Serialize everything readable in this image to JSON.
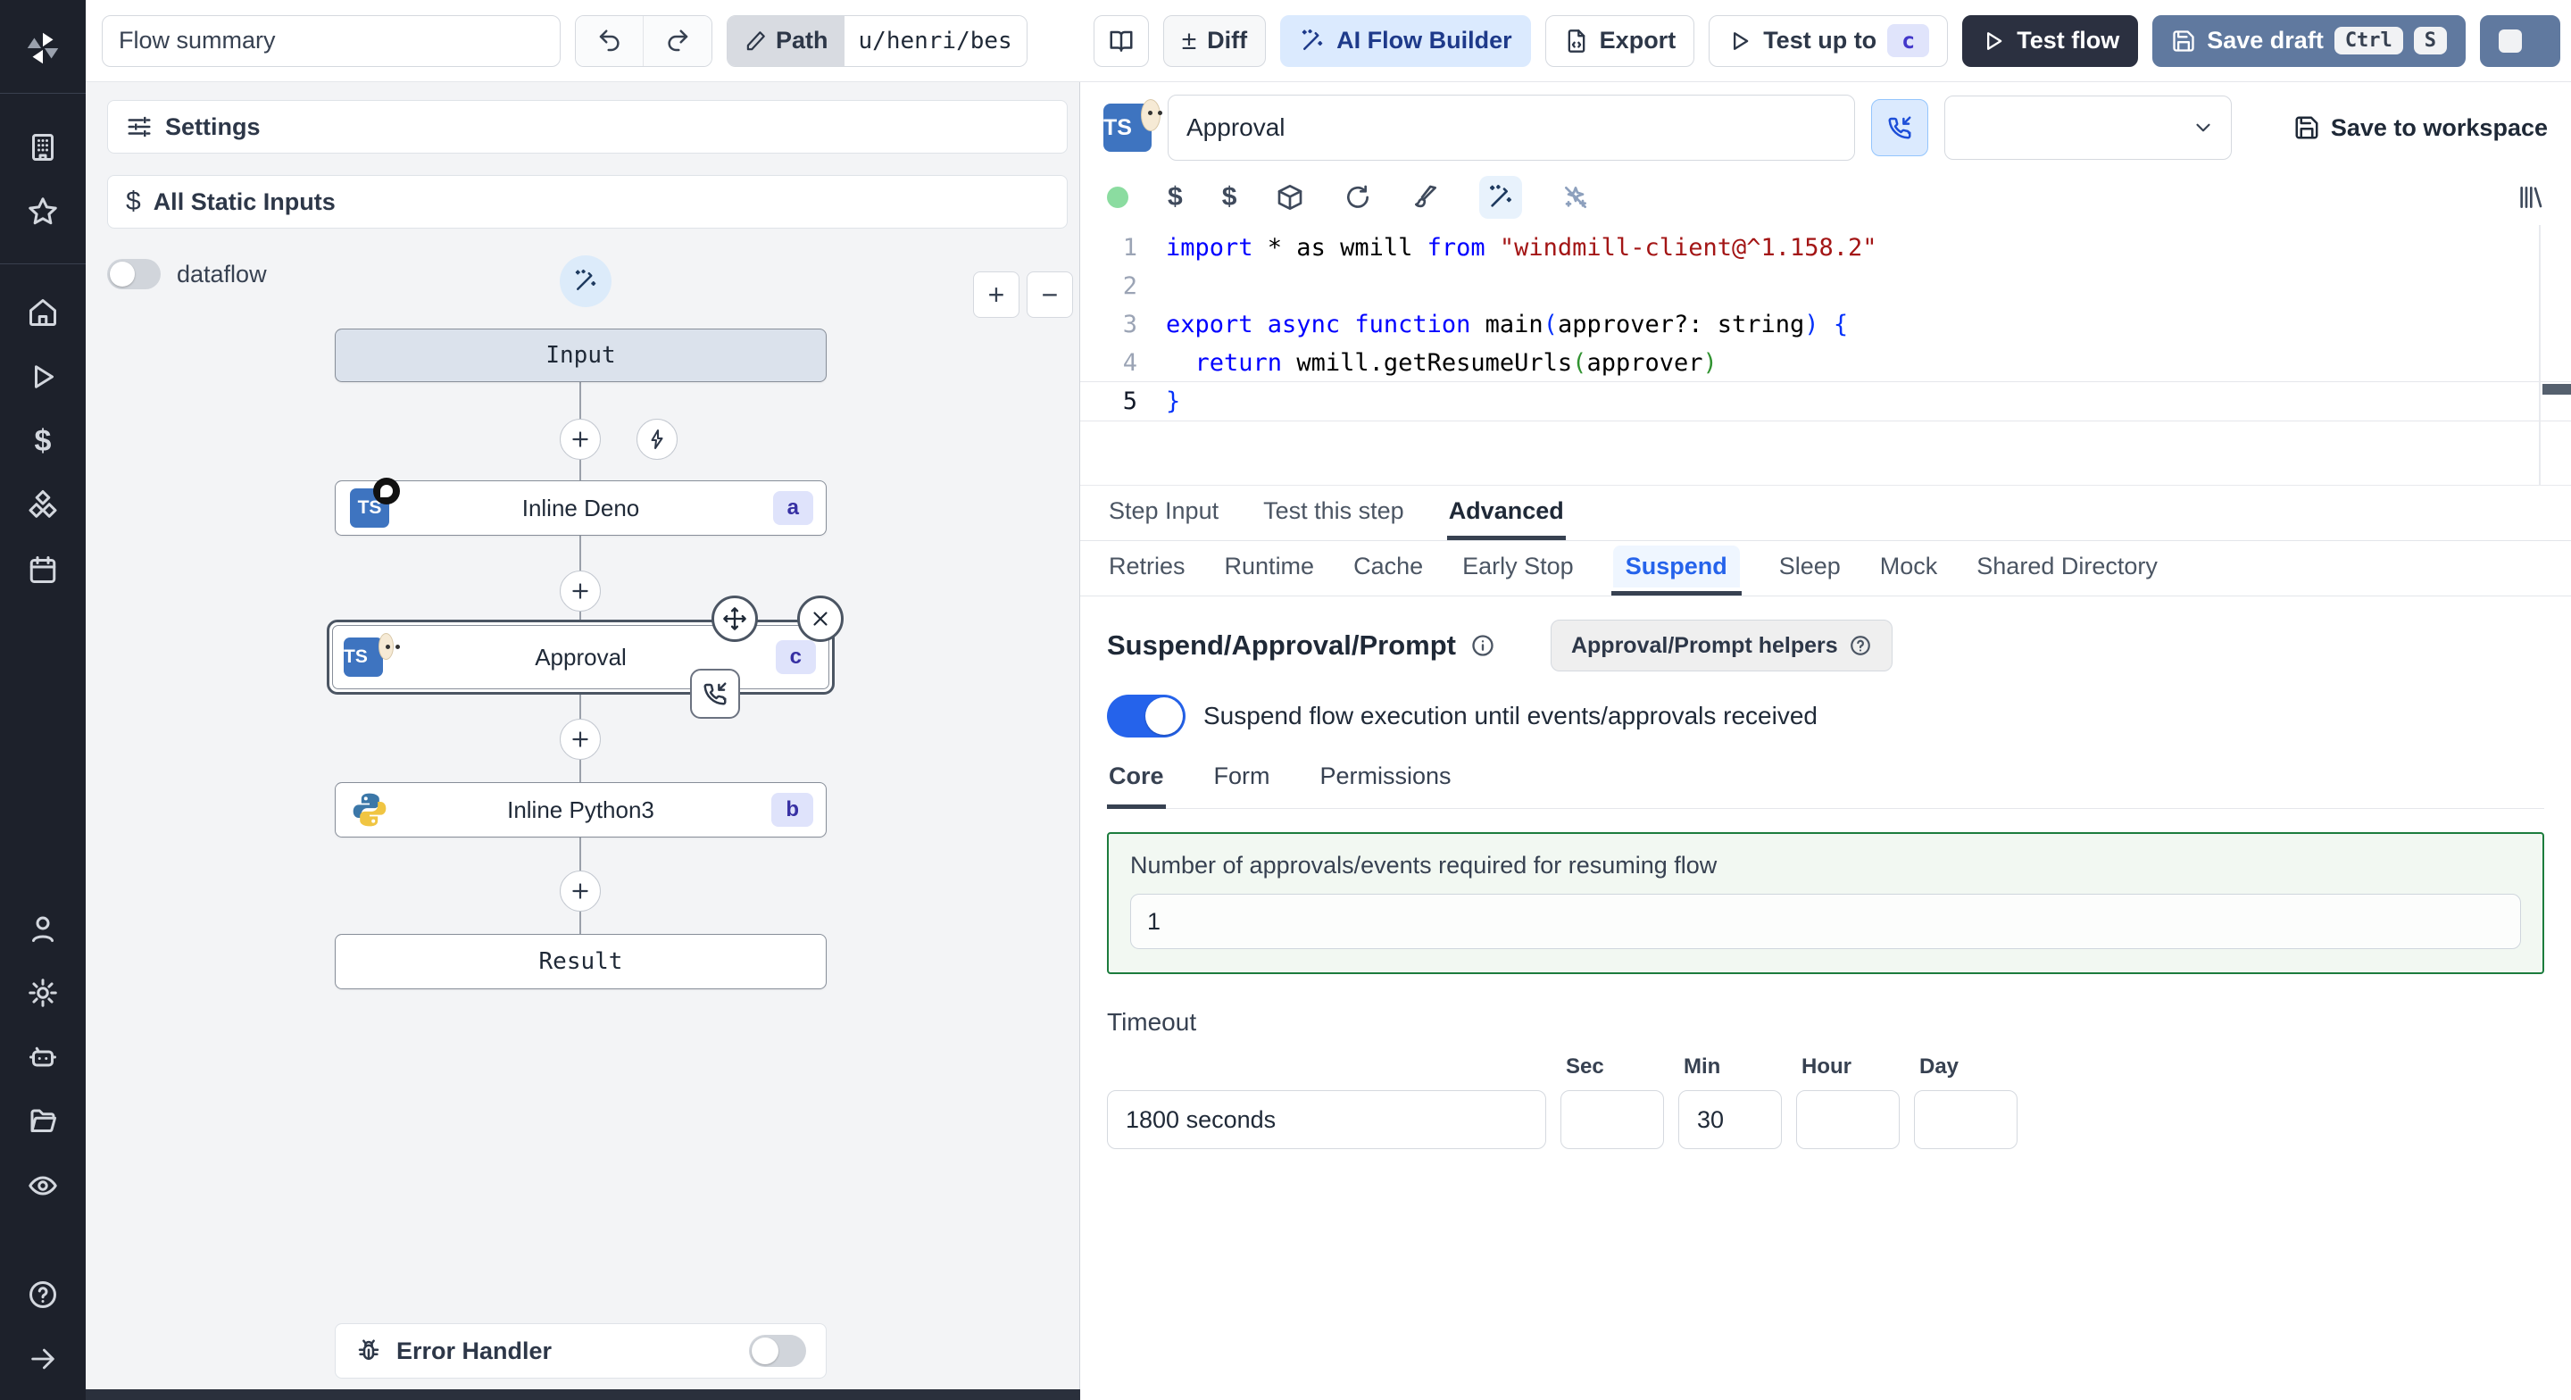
{
  "toolbar": {
    "flow_summary_value": "Flow summary",
    "path_label": "Path",
    "path_value": "u/henri/bes",
    "diff_symbol": "±",
    "diff_label": "Diff",
    "ai_flow_builder_label": "AI Flow Builder",
    "export_label": "Export",
    "test_up_to_label": "Test up to",
    "test_up_to_badge": "c",
    "test_flow_label": "Test flow",
    "save_draft_label": "Save draft",
    "save_draft_kbd_1": "Ctrl",
    "save_draft_kbd_2": "S"
  },
  "rail": {
    "icons": [
      "windmill-logo",
      "building",
      "star",
      "home",
      "play",
      "dollar",
      "cubes",
      "calendar",
      "user",
      "gear",
      "robot",
      "folder",
      "eye",
      "help",
      "arrow-right"
    ],
    "dollar_glyph": "$"
  },
  "flow_panel": {
    "settings_label": "Settings",
    "static_inputs_label": "All Static Inputs",
    "static_inputs_glyph": "$",
    "dataflow_label": "dataflow",
    "zoom_in_glyph": "+",
    "zoom_out_glyph": "−",
    "input_node_label": "Input",
    "deno_node": {
      "label": "Inline Deno",
      "badge": "a",
      "tile": "TS"
    },
    "approval_node": {
      "label": "Approval",
      "badge": "c",
      "tile": "TS"
    },
    "python_node": {
      "label": "Inline Python3",
      "badge": "b"
    },
    "result_node_label": "Result",
    "error_handler_label": "Error Handler"
  },
  "rp_header": {
    "tile": "TS",
    "step_name_value": "Approval",
    "save_to_workspace_label": "Save to workspace"
  },
  "code": {
    "lines": [
      {
        "num": "1",
        "tokens": [
          {
            "t": "import ",
            "c": "kw"
          },
          {
            "t": "* as wmill ",
            "c": "pl"
          },
          {
            "t": "from ",
            "c": "kw"
          },
          {
            "t": "\"windmill-client@^1.158.2\"",
            "c": "str"
          }
        ]
      },
      {
        "num": "2",
        "tokens": []
      },
      {
        "num": "3",
        "tokens": [
          {
            "t": "export ",
            "c": "kw"
          },
          {
            "t": "async ",
            "c": "kw"
          },
          {
            "t": "function ",
            "c": "kw"
          },
          {
            "t": "main",
            "c": "pl"
          },
          {
            "t": "(",
            "c": "br1"
          },
          {
            "t": "approver?: string",
            "c": "pl"
          },
          {
            "t": ")",
            "c": "br1"
          },
          {
            "t": " {",
            "c": "br1"
          }
        ]
      },
      {
        "num": "4",
        "tokens": [
          {
            "t": "  ",
            "c": "pl"
          },
          {
            "t": "return ",
            "c": "kw"
          },
          {
            "t": "wmill.getResumeUrls",
            "c": "pl"
          },
          {
            "t": "(",
            "c": "br2"
          },
          {
            "t": "approver",
            "c": "pl"
          },
          {
            "t": ")",
            "c": "br2"
          }
        ]
      },
      {
        "num": "5",
        "current": true,
        "tokens": [
          {
            "t": "}",
            "c": "br1"
          }
        ]
      }
    ]
  },
  "tabs": {
    "items": [
      "Step Input",
      "Test this step",
      "Advanced"
    ],
    "active": "Advanced"
  },
  "subtabs": {
    "items": [
      "Retries",
      "Runtime",
      "Cache",
      "Early Stop",
      "Suspend",
      "Sleep",
      "Mock",
      "Shared Directory"
    ],
    "active": "Suspend"
  },
  "suspend": {
    "heading": "Suspend/Approval/Prompt",
    "helpers_button_label": "Approval/Prompt helpers",
    "toggle_text": "Suspend flow execution until events/approvals received",
    "core_tabs": [
      "Core",
      "Form",
      "Permissions"
    ],
    "core_active": "Core",
    "approvals_label": "Number of approvals/events required for resuming flow",
    "approvals_value": "1",
    "timeout_label": "Timeout",
    "timeout_value": "1800 seconds",
    "units": [
      {
        "label": "Sec",
        "value": ""
      },
      {
        "label": "Min",
        "value": "30"
      },
      {
        "label": "Hour",
        "value": ""
      },
      {
        "label": "Day",
        "value": ""
      }
    ]
  },
  "colors": {
    "accent_blue": "#2563eb",
    "ai_button_bg": "#dbeafe",
    "save_draft_bg": "#60799f",
    "dark_button_bg": "#2b3040",
    "suspend_green_border": "#1c7c3d",
    "badge_bg": "#dfe3fb",
    "badge_text": "#3730a3",
    "rail_bg": "#1d212b",
    "flow_panel_bg": "#f3f4f6"
  }
}
